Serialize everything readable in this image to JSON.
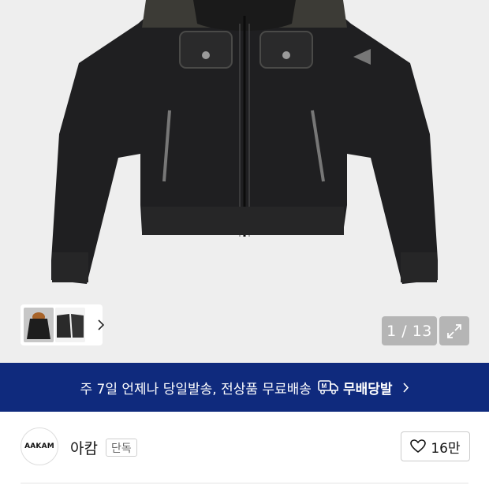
{
  "gallery": {
    "counter": "1 / 13",
    "thumbnails": [
      {
        "name": "thumb-1",
        "active": true
      },
      {
        "name": "thumb-2",
        "active": false
      }
    ]
  },
  "banner": {
    "text": "주 7일 언제나 당일발송, 전상품 무료배송",
    "badge_label": "무배당발",
    "badge_icon_letter": "M",
    "background": "#0f2a7d"
  },
  "store": {
    "logo_text": "AAKAM",
    "name": "아캄",
    "tag": "단독",
    "likes": "16만"
  },
  "icons": {
    "expand": "expand-icon",
    "heart": "heart-icon",
    "chevron": "chevron-right-icon",
    "truck": "delivery-truck-icon"
  }
}
